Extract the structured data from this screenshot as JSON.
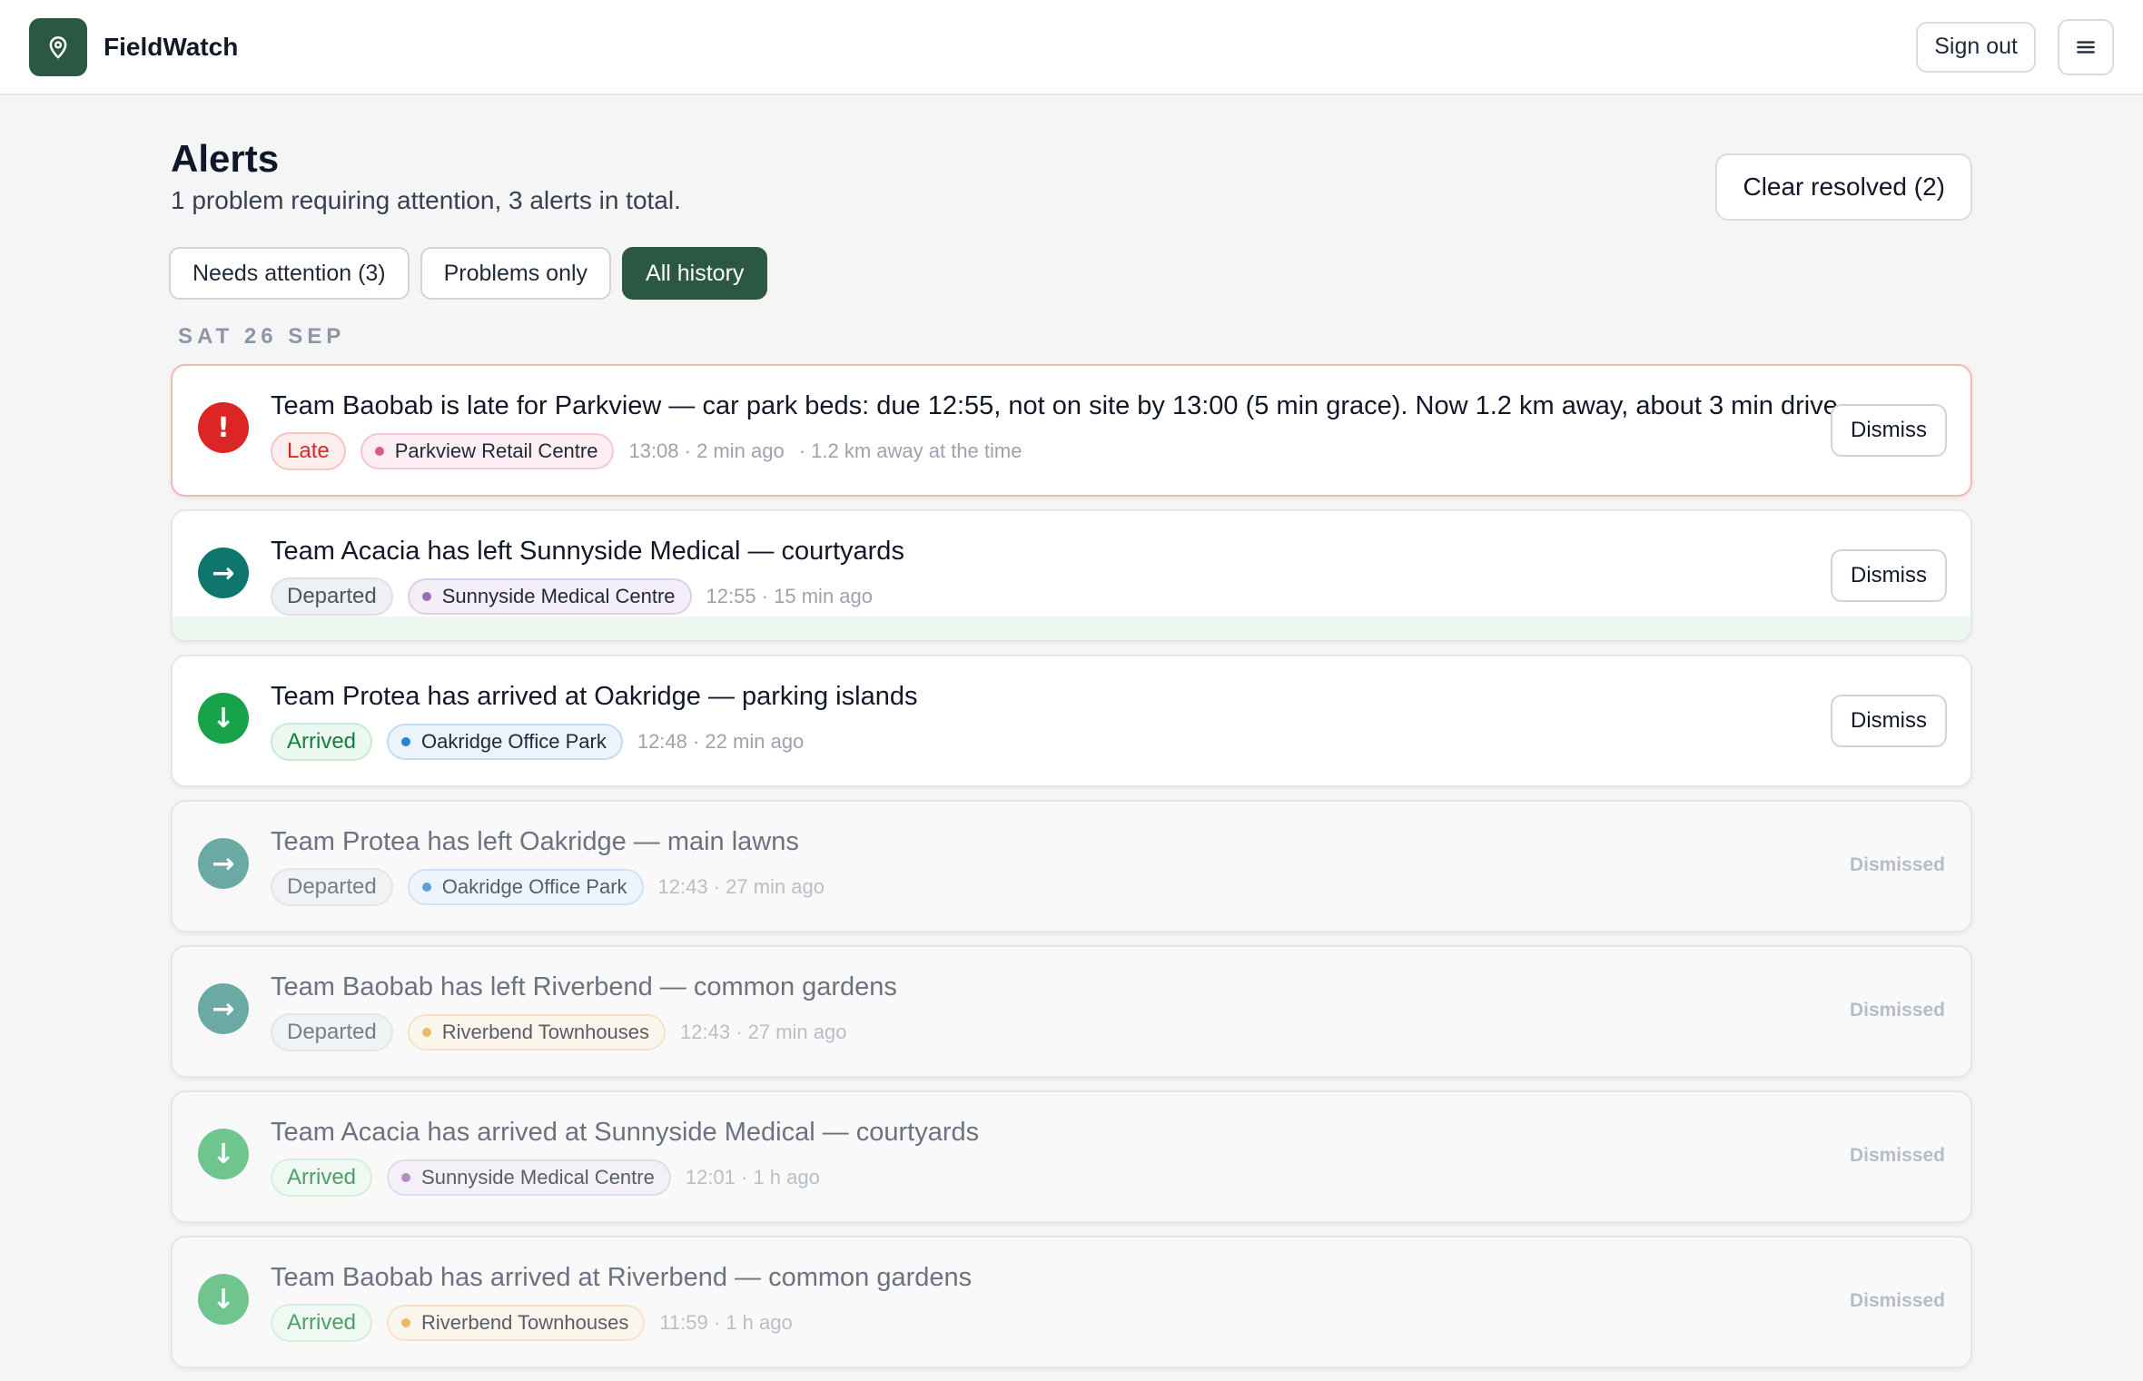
{
  "app": {
    "name": "FieldWatch",
    "sign_out_label": "Sign out",
    "logo_icon": "map-pin-icon",
    "menu_icon": "hamburger-menu-icon",
    "brand_color": "#2b5842"
  },
  "page": {
    "title": "Alerts",
    "subtitle": "1 problem requiring attention, 3 alerts in total.",
    "clear_resolved_label": "Clear resolved (2)"
  },
  "filters": [
    {
      "label": "Needs attention (3)",
      "active": false
    },
    {
      "label": "Problems only",
      "active": false
    },
    {
      "label": "All history",
      "active": true
    }
  ],
  "date_group": "SAT 26 SEP",
  "alerts": [
    {
      "kind": "late",
      "icon": "exclamation-icon",
      "icon_glyph": "!",
      "title": "Team Baobab is late for Parkview — car park beds: due 12:55, not on site by 13:00 (5 min grace). Now 1.2 km away, about 3 min drive.",
      "tag": "Late",
      "site": "Parkview Retail Centre",
      "site_color": "#db5a86",
      "meta": "13:08 · 2 min ago",
      "extra": "· 1.2 km away at the time",
      "dismissed": false,
      "action_label": "Dismiss"
    },
    {
      "kind": "departed",
      "icon": "arrow-right-icon",
      "icon_glyph": "→",
      "title": "Team Acacia has left Sunnyside Medical — courtyards",
      "tag": "Departed",
      "site": "Sunnyside Medical Centre",
      "site_color": "#9b6fb0",
      "meta": "12:55 · 15 min ago",
      "extra": "",
      "dismissed": false,
      "action_label": "Dismiss"
    },
    {
      "kind": "arrived",
      "icon": "arrow-down-icon",
      "icon_glyph": "↓",
      "title": "Team Protea has arrived at Oakridge — parking islands",
      "tag": "Arrived",
      "site": "Oakridge Office Park",
      "site_color": "#2f80d1",
      "meta": "12:48 · 22 min ago",
      "extra": "",
      "dismissed": false,
      "action_label": "Dismiss"
    },
    {
      "kind": "departed",
      "icon": "arrow-right-icon",
      "icon_glyph": "→",
      "title": "Team Protea has left Oakridge — main lawns",
      "tag": "Departed",
      "site": "Oakridge Office Park",
      "site_color": "#2f80d1",
      "meta": "12:43 · 27 min ago",
      "extra": "",
      "dismissed": true,
      "action_label": "Dismissed"
    },
    {
      "kind": "departed",
      "icon": "arrow-right-icon",
      "icon_glyph": "→",
      "title": "Team Baobab has left Riverbend — common gardens",
      "tag": "Departed",
      "site": "Riverbend Townhouses",
      "site_color": "#e9a23b",
      "meta": "12:43 · 27 min ago",
      "extra": "",
      "dismissed": true,
      "action_label": "Dismissed"
    },
    {
      "kind": "arrived",
      "icon": "arrow-down-icon",
      "icon_glyph": "↓",
      "title": "Team Acacia has arrived at Sunnyside Medical — courtyards",
      "tag": "Arrived",
      "site": "Sunnyside Medical Centre",
      "site_color": "#9b6fb0",
      "meta": "12:01 · 1 h ago",
      "extra": "",
      "dismissed": true,
      "action_label": "Dismissed"
    },
    {
      "kind": "arrived",
      "icon": "arrow-down-icon",
      "icon_glyph": "↓",
      "title": "Team Baobab has arrived at Riverbend — common gardens",
      "tag": "Arrived",
      "site": "Riverbend Townhouses",
      "site_color": "#e9a23b",
      "meta": "11:59 · 1 h ago",
      "extra": "",
      "dismissed": true,
      "action_label": "Dismissed"
    }
  ]
}
